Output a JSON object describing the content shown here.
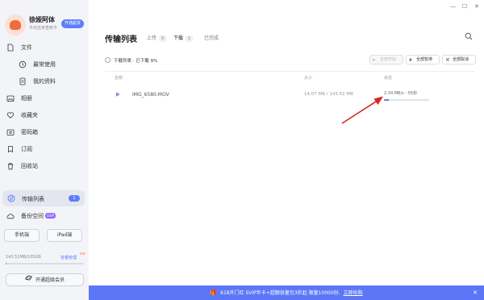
{
  "profile": {
    "name": "徐娅阿体",
    "subtitle": "今日还未签到卡",
    "premium_button": "开通超享"
  },
  "sidebar": {
    "items": [
      {
        "label": "文件",
        "icon": "file-icon"
      },
      {
        "label": "最常使用",
        "icon": "clock-icon"
      },
      {
        "label": "我的资料",
        "icon": "document-icon"
      },
      {
        "label": "相册",
        "icon": "photo-icon"
      },
      {
        "label": "收藏夹",
        "icon": "heart-icon"
      },
      {
        "label": "密码箱",
        "icon": "lock-box-icon"
      },
      {
        "label": "订阅",
        "icon": "bookmark-icon"
      },
      {
        "label": "回收站",
        "icon": "trash-icon"
      }
    ],
    "transfer": {
      "label": "传输列表",
      "badge": "1"
    },
    "backup": {
      "label": "备份空间",
      "tag": "SVIP"
    },
    "phone_button": "手机端",
    "ipad_button": "iPad端",
    "storage_text": "143.52MB/105GB",
    "storage_link": "容量管理",
    "storage_hot": "hot",
    "storage_fraction": 0.0014,
    "open_svip_button": "开通超级会员"
  },
  "main": {
    "title": "传输列表",
    "tabs": [
      {
        "label": "上传",
        "count": "0"
      },
      {
        "label": "下载",
        "count": "1"
      },
      {
        "label": "已完成",
        "count": ""
      }
    ],
    "list_status": "下载列表 · 已下载 9%",
    "actions": {
      "start_all": "全部开始",
      "pause_all": "全部暂停",
      "cancel_all": "全部取消"
    },
    "columns": {
      "name": "名称",
      "size": "大小",
      "status": "状态"
    },
    "rows": [
      {
        "name": "IMG_6580.MOV",
        "size": "14.07 MB / 143.52 MB",
        "speed": "2.34 MB/s - 55秒",
        "progress": 0.1
      }
    ]
  },
  "promo": {
    "text": "618开门红 SVIP年卡+超额容量包3折起 限量10000份,",
    "link": "立即抢购"
  },
  "colors": {
    "accent": "#5c7dfa",
    "promo_bg": "#5c76f7",
    "annotation_red": "#d6261f"
  }
}
